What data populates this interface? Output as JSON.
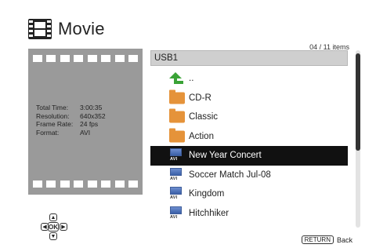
{
  "header": {
    "title": "Movie"
  },
  "details": [
    {
      "label": "Total Time:",
      "value": "3:00:35"
    },
    {
      "label": "Resolution:",
      "value": "640x352"
    },
    {
      "label": "Frame Rate:",
      "value": "24 fps"
    },
    {
      "label": "Format:",
      "value": "AVI"
    }
  ],
  "list": {
    "counter": "04 / 11 items",
    "path": "USB1",
    "items": [
      {
        "label": "..",
        "icon": "up-arrow-icon"
      },
      {
        "label": "CD-R",
        "icon": "folder-icon"
      },
      {
        "label": "Classic",
        "icon": "folder-icon"
      },
      {
        "label": "Action",
        "icon": "folder-icon"
      },
      {
        "label": "New Year Concert",
        "icon": "avi-file-icon",
        "badge": "AVI"
      },
      {
        "label": "Soccer Match Jul-08",
        "icon": "avi-file-icon",
        "badge": "AVI"
      },
      {
        "label": "Kingdom",
        "icon": "avi-file-icon",
        "badge": "AVI"
      },
      {
        "label": "Hitchhiker",
        "icon": "avi-file-icon",
        "badge": "AVI"
      }
    ],
    "selected_index": 4
  },
  "nav": {
    "ok": "OK",
    "up": "▲",
    "down": "▼",
    "left": "◀",
    "right": "▶"
  },
  "footer": {
    "return_key": "RETURN",
    "return_label": "Back"
  },
  "colors": {
    "selected_bg": "#111111",
    "folder": "#e5933a",
    "up_arrow": "#3aa336",
    "panel": "#9a9a9a"
  }
}
